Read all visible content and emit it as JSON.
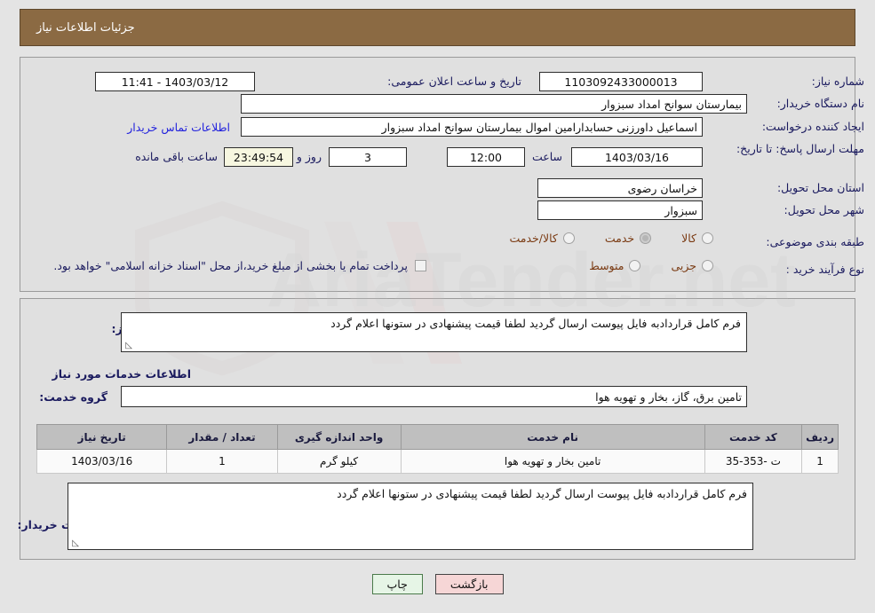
{
  "header": {
    "title": "جزئیات اطلاعات نیاز"
  },
  "top": {
    "need_number_label": "شماره نیاز:",
    "need_number_value": "1103092433000013",
    "announce_label": "تاریخ و ساعت اعلان عمومی:",
    "announce_value": "11:41 - 1403/03/12",
    "buyer_org_label": "نام دستگاه خریدار:",
    "buyer_org_value": "بیمارستان سوانح امداد سبزوار",
    "requester_label": "ایجاد کننده درخواست:",
    "requester_value": "اسماعیل داورزنی حسابدارامین اموال بیمارستان سوانح امداد سبزوار",
    "contact_link": "اطلاعات تماس خریدار",
    "deadline_label": "مهلت ارسال پاسخ: تا تاریخ:",
    "deadline_date": "1403/03/16",
    "hour_label": "ساعت",
    "deadline_time": "12:00",
    "days_value": "3",
    "days_label": "روز و",
    "countdown_value": "23:49:54",
    "remaining_label": "ساعت باقی مانده",
    "province_label": "استان محل تحویل:",
    "province_value": "خراسان رضوی",
    "city_label": "شهر محل تحویل:",
    "city_value": "سبزوار",
    "category_label": "طبقه بندی موضوعی:",
    "category_options": [
      {
        "label": "کالا",
        "selected": false
      },
      {
        "label": "خدمت",
        "selected": true
      },
      {
        "label": "کالا/خدمت",
        "selected": false
      }
    ],
    "process_label": "نوع فرآیند خرید :",
    "process_options": [
      {
        "label": "جزیی",
        "selected": false
      },
      {
        "label": "متوسط",
        "selected": false
      }
    ],
    "treasury_checkbox_label": "پرداخت تمام یا بخشی از مبلغ خرید،از محل \"اسناد خزانه اسلامی\" خواهد بود."
  },
  "middle": {
    "summary_label": "شرح کلی نیاز:",
    "summary_value": "فرم کامل قراردادبه فایل پیوست ارسال گردید لطفا قیمت پیشنهادی در ستونها اعلام گردد",
    "services_title": "اطلاعات خدمات مورد نیاز",
    "service_group_label": "گروه خدمت:",
    "service_group_value": "تامین برق، گاز، بخار و تهویه هوا",
    "notes_label": "توضیحات خریدار:",
    "notes_value": "فرم کامل قراردادبه فایل پیوست ارسال گردید لطفا قیمت پیشنهادی در ستونها اعلام گردد"
  },
  "table": {
    "columns": [
      "ردیف",
      "کد خدمت",
      "نام خدمت",
      "واحد اندازه گیری",
      "تعداد / مقدار",
      "تاریخ نیاز"
    ],
    "rows": [
      {
        "row_no": "1",
        "service_code": "ت -353-35",
        "service_name": "تامین بخار و تهویه هوا",
        "unit": "کیلو گرم",
        "quantity": "1",
        "need_date": "1403/03/16"
      }
    ]
  },
  "buttons": {
    "back": "بازگشت",
    "print": "چاپ"
  },
  "watermark": {
    "text": "AriaTender.net"
  },
  "colors": {
    "header_bg": "#8b6a43",
    "label": "#1a1a5e",
    "link": "#2222dd",
    "option": "#8a3b10",
    "back_btn": "#f6d6d6",
    "print_btn": "#e6f5e6"
  }
}
